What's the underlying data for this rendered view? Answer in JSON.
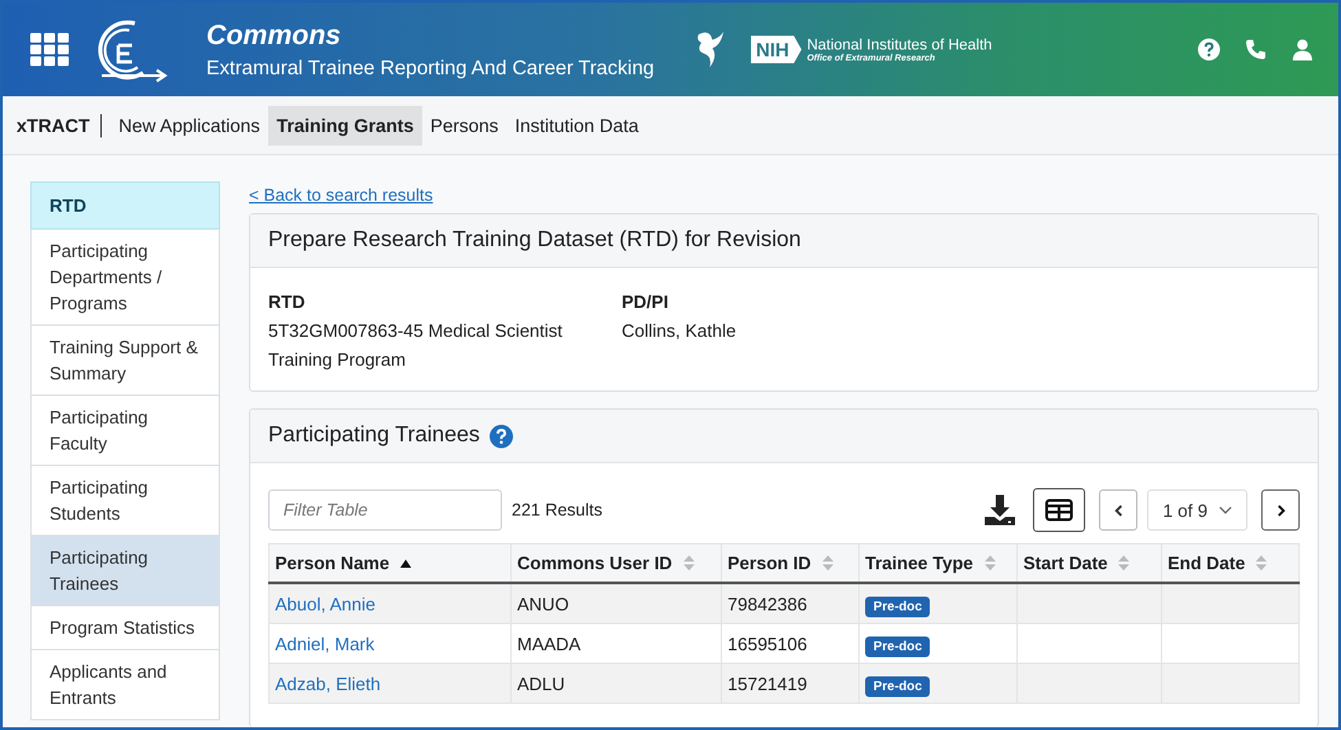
{
  "header": {
    "title": "Commons",
    "subtitle": "Extramural Trainee Reporting And Career Tracking",
    "nih_badge": "NIH",
    "nih_name": "National Institutes of Health",
    "nih_office": "Office of Extramural Research"
  },
  "nav": {
    "brand": "xTRACT",
    "items": [
      {
        "label": "New Applications",
        "selected": false
      },
      {
        "label": "Training Grants",
        "selected": true
      },
      {
        "label": "Persons",
        "selected": false
      },
      {
        "label": "Institution Data",
        "selected": false
      }
    ]
  },
  "sidebar": {
    "heading": "RTD",
    "items": [
      {
        "label": "Participating Departments / Programs",
        "selected": false
      },
      {
        "label": "Training Support & Summary",
        "selected": false
      },
      {
        "label": "Participating Faculty",
        "selected": false
      },
      {
        "label": "Participating Students",
        "selected": false
      },
      {
        "label": "Participating Trainees",
        "selected": true
      },
      {
        "label": "Program Statistics",
        "selected": false
      },
      {
        "label": "Applicants and Entrants",
        "selected": false
      }
    ]
  },
  "back_link": "< Back to search results",
  "summary": {
    "title": "Prepare Research Training Dataset (RTD) for Revision",
    "fields": [
      {
        "label": "RTD",
        "value": "5T32GM007863-45 Medical Scientist Training Program"
      },
      {
        "label": "PD/PI",
        "value": "Collins, Kathle"
      }
    ]
  },
  "trainees": {
    "title": "Participating Trainees",
    "filter": {
      "placeholder": "Filter Table"
    },
    "results": "221 Results",
    "page": "1 of 9",
    "table": {
      "columns": [
        {
          "label": "Person Name",
          "sorted": true
        },
        {
          "label": "Commons User ID",
          "sorted": false
        },
        {
          "label": "Person ID",
          "sorted": false
        },
        {
          "label": "Trainee Type",
          "sorted": false
        },
        {
          "label": "Start Date",
          "sorted": false
        },
        {
          "label": "End Date",
          "sorted": false
        }
      ],
      "rows": [
        {
          "name": "Abuol, Annie",
          "user_id": "ANUO",
          "person_id": "79842386",
          "type": "Pre-doc"
        },
        {
          "name": "Adniel, Mark",
          "user_id": "MAADA",
          "person_id": "16595106",
          "type": "Pre-doc"
        },
        {
          "name": "Adzab, Elieth",
          "user_id": "ADLU",
          "person_id": "15721419",
          "type": "Pre-doc"
        }
      ]
    }
  }
}
